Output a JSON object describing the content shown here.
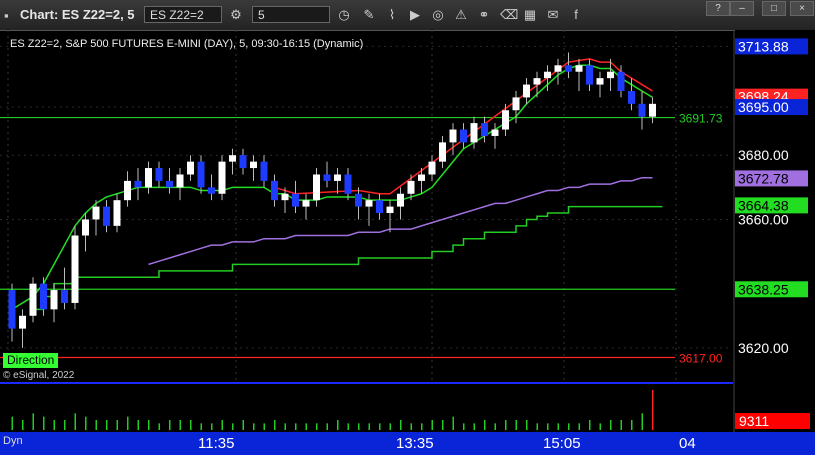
{
  "window": {
    "title": "Chart: ES Z22=2, 5",
    "symbol_field": "ES Z22=2",
    "interval_field": "5",
    "buttons": [
      "?",
      "–",
      "□",
      "×"
    ]
  },
  "chart_header": "ES Z22=2, S&P 500 FUTURES E-MINI (DAY), 5, 09:30-16:15 (Dynamic)",
  "copyright": "© eSignal, 2022",
  "direction_label": "Direction",
  "bottom_bar": {
    "dyn_label": "Dyn",
    "time_labels": [
      "11:35",
      "13:35",
      "15:05",
      "04"
    ]
  },
  "colors": {
    "bull_candle": "#ffffff",
    "bear_candle": "#1e3cff",
    "ma_fast": "#22dd22",
    "ma_red": "#ff2222",
    "ma_purple": "#a070e0",
    "level_green": "#22cc22",
    "level_red": "#ff2222",
    "volume": "#22cc22",
    "axis_bg": "#0a24d8"
  },
  "chart_data": {
    "type": "candlestick",
    "symbol": "ES Z22=2",
    "interval": "5",
    "y_tick_labels": [
      "3620.00",
      "3660.00",
      "3680.00",
      "3695.00",
      "3713.88"
    ],
    "price_tags": [
      {
        "value": 3713.88,
        "label": "3713.88",
        "color": "#0a24d8",
        "text_color": "#ffffff"
      },
      {
        "value": 3698.24,
        "label": "3698.24",
        "color": "#ff2222",
        "text_color": "#ffffff"
      },
      {
        "value": 3695.0,
        "label": "3695.00",
        "color": "#0a24d8",
        "text_color": "#ffffff"
      },
      {
        "value": 3672.78,
        "label": "3672.78",
        "color": "#a070e0",
        "text_color": "#000000"
      },
      {
        "value": 3664.38,
        "label": "3664.38",
        "color": "#22dd22",
        "text_color": "#000000"
      },
      {
        "value": 3638.25,
        "label": "3638.25",
        "color": "#22dd22",
        "text_color": "#000000"
      }
    ],
    "horizontal_levels": [
      {
        "value": 3691.73,
        "label": "3691.73",
        "color": "#22cc22"
      },
      {
        "value": 3638.25,
        "label": "",
        "color": "#22cc22"
      },
      {
        "value": 3617.0,
        "label": "3617.00",
        "color": "#ff2222"
      }
    ],
    "volume_last": "9311",
    "candles": [
      [
        3638,
        3640,
        3622,
        3626
      ],
      [
        3626,
        3632,
        3620,
        3630
      ],
      [
        3630,
        3642,
        3628,
        3640
      ],
      [
        3640,
        3642,
        3630,
        3632
      ],
      [
        3632,
        3640,
        3628,
        3638
      ],
      [
        3638,
        3645,
        3632,
        3634
      ],
      [
        3634,
        3658,
        3632,
        3655
      ],
      [
        3655,
        3662,
        3650,
        3660
      ],
      [
        3660,
        3666,
        3655,
        3664
      ],
      [
        3664,
        3666,
        3656,
        3658
      ],
      [
        3658,
        3668,
        3656,
        3666
      ],
      [
        3666,
        3675,
        3664,
        3672
      ],
      [
        3672,
        3676,
        3666,
        3670
      ],
      [
        3670,
        3678,
        3668,
        3676
      ],
      [
        3676,
        3678,
        3670,
        3672
      ],
      [
        3672,
        3676,
        3668,
        3670
      ],
      [
        3670,
        3676,
        3666,
        3674
      ],
      [
        3674,
        3680,
        3672,
        3678
      ],
      [
        3678,
        3680,
        3668,
        3670
      ],
      [
        3670,
        3674,
        3666,
        3668
      ],
      [
        3668,
        3680,
        3666,
        3678
      ],
      [
        3678,
        3682,
        3674,
        3680
      ],
      [
        3680,
        3682,
        3674,
        3676
      ],
      [
        3676,
        3680,
        3672,
        3678
      ],
      [
        3678,
        3680,
        3670,
        3672
      ],
      [
        3672,
        3674,
        3664,
        3666
      ],
      [
        3666,
        3670,
        3662,
        3668
      ],
      [
        3668,
        3672,
        3662,
        3664
      ],
      [
        3664,
        3668,
        3660,
        3666
      ],
      [
        3666,
        3676,
        3664,
        3674
      ],
      [
        3674,
        3678,
        3670,
        3672
      ],
      [
        3672,
        3676,
        3668,
        3674
      ],
      [
        3674,
        3676,
        3666,
        3668
      ],
      [
        3668,
        3670,
        3660,
        3664
      ],
      [
        3664,
        3668,
        3658,
        3666
      ],
      [
        3666,
        3668,
        3660,
        3662
      ],
      [
        3662,
        3666,
        3656,
        3664
      ],
      [
        3664,
        3670,
        3660,
        3668
      ],
      [
        3668,
        3674,
        3666,
        3672
      ],
      [
        3672,
        3676,
        3668,
        3674
      ],
      [
        3674,
        3680,
        3672,
        3678
      ],
      [
        3678,
        3686,
        3676,
        3684
      ],
      [
        3684,
        3690,
        3680,
        3688
      ],
      [
        3688,
        3690,
        3682,
        3684
      ],
      [
        3684,
        3692,
        3682,
        3690
      ],
      [
        3690,
        3692,
        3684,
        3686
      ],
      [
        3686,
        3690,
        3682,
        3688
      ],
      [
        3688,
        3696,
        3686,
        3694
      ],
      [
        3694,
        3700,
        3690,
        3698
      ],
      [
        3698,
        3704,
        3696,
        3702
      ],
      [
        3702,
        3706,
        3698,
        3704
      ],
      [
        3704,
        3708,
        3700,
        3706
      ],
      [
        3706,
        3710,
        3702,
        3708
      ],
      [
        3708,
        3712,
        3704,
        3706
      ],
      [
        3706,
        3710,
        3700,
        3708
      ],
      [
        3708,
        3710,
        3700,
        3702
      ],
      [
        3702,
        3706,
        3698,
        3704
      ],
      [
        3704,
        3710,
        3700,
        3706
      ],
      [
        3706,
        3708,
        3698,
        3700
      ],
      [
        3700,
        3704,
        3694,
        3696
      ],
      [
        3696,
        3700,
        3688,
        3692
      ],
      [
        3692,
        3698,
        3690,
        3696
      ]
    ],
    "ma_fast": [
      3632,
      3634,
      3636,
      3640,
      3646,
      3652,
      3658,
      3662,
      3665,
      3667,
      3668,
      3669,
      3670,
      3670,
      3670,
      3670,
      3670,
      3670,
      3669,
      3669,
      3669,
      3670,
      3670,
      3670,
      3670,
      3668,
      3668,
      3666,
      3666,
      3666,
      3667,
      3667,
      3667,
      3667,
      3666,
      3666,
      3666,
      3666,
      3667,
      3668,
      3670,
      3674,
      3678,
      3682,
      3684,
      3686,
      3688,
      3690,
      3692,
      3696,
      3699,
      3702,
      3705,
      3707,
      3708,
      3708,
      3707,
      3707,
      3704,
      3702,
      3700,
      3698
    ],
    "ma_purple": [
      null,
      null,
      null,
      null,
      null,
      null,
      null,
      null,
      null,
      null,
      null,
      null,
      null,
      3646,
      3647,
      3648,
      3649,
      3650,
      3651,
      3652,
      3652,
      3653,
      3653,
      3653,
      3654,
      3654,
      3654,
      3655,
      3655,
      3655,
      3655,
      3655,
      3655,
      3656,
      3656,
      3656,
      3657,
      3657,
      3657,
      3658,
      3659,
      3660,
      3661,
      3662,
      3663,
      3664,
      3665,
      3665,
      3666,
      3667,
      3668,
      3669,
      3669,
      3670,
      3670,
      3671,
      3671,
      3671,
      3672,
      3672,
      3673,
      3673
    ],
    "stepped_line": [
      null,
      null,
      3632,
      3636,
      3640,
      3640,
      3642,
      3642,
      3642,
      3642,
      3642,
      3642,
      3642,
      3642,
      3644,
      3644,
      3644,
      3644,
      3644,
      3644,
      3644,
      3646,
      3646,
      3646,
      3646,
      3646,
      3646,
      3646,
      3646,
      3646,
      3646,
      3646,
      3646,
      3648,
      3648,
      3648,
      3648,
      3648,
      3648,
      3648,
      3650,
      3650,
      3652,
      3654,
      3654,
      3656,
      3656,
      3656,
      3658,
      3660,
      3661,
      3662,
      3662,
      3664,
      3664,
      3664,
      3664,
      3664,
      3664,
      3664,
      3664,
      3664
    ],
    "volume": [
      4,
      3,
      5,
      4,
      3,
      3,
      5,
      4,
      3,
      3,
      3,
      4,
      3,
      3,
      2,
      3,
      3,
      3,
      2,
      2,
      3,
      2,
      3,
      2,
      2,
      3,
      2,
      2,
      2,
      2,
      2,
      3,
      2,
      2,
      2,
      2,
      2,
      3,
      2,
      2,
      3,
      3,
      4,
      2,
      2,
      3,
      2,
      3,
      3,
      3,
      2,
      2,
      2,
      2,
      2,
      3,
      2,
      3,
      3,
      3,
      5,
      12
    ]
  }
}
